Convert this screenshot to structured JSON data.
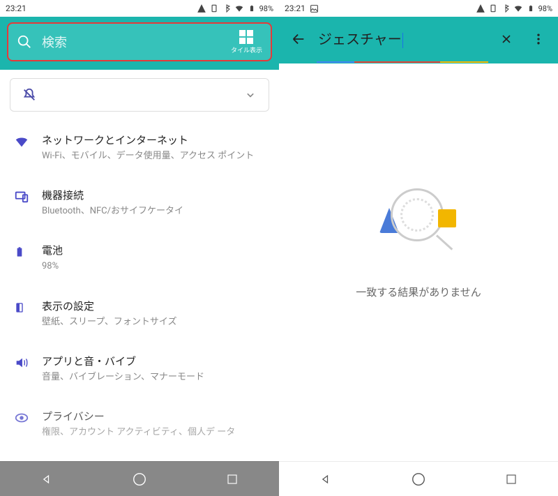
{
  "status": {
    "time": "23:21",
    "battery_pct": "98%"
  },
  "left": {
    "search_placeholder": "検索",
    "tile_label": "タイル表示",
    "items": [
      {
        "title": "ネットワークとインターネット",
        "sub": "Wi-Fi、モバイル、データ使用量、アクセス ポイント"
      },
      {
        "title": "機器接続",
        "sub": "Bluetooth、NFC/おサイフケータイ"
      },
      {
        "title": "電池",
        "sub": "98%"
      },
      {
        "title": "表示の設定",
        "sub": "壁紙、スリープ、フォントサイズ"
      },
      {
        "title": "アプリと音・バイブ",
        "sub": "音量、バイブレーション、マナーモード"
      },
      {
        "title": "プライバシー",
        "sub": "権限、アカウント アクティビティ、個人デ ータ"
      }
    ]
  },
  "right": {
    "search_query": "ジェスチャー",
    "empty_text": "一致する結果がありません"
  }
}
